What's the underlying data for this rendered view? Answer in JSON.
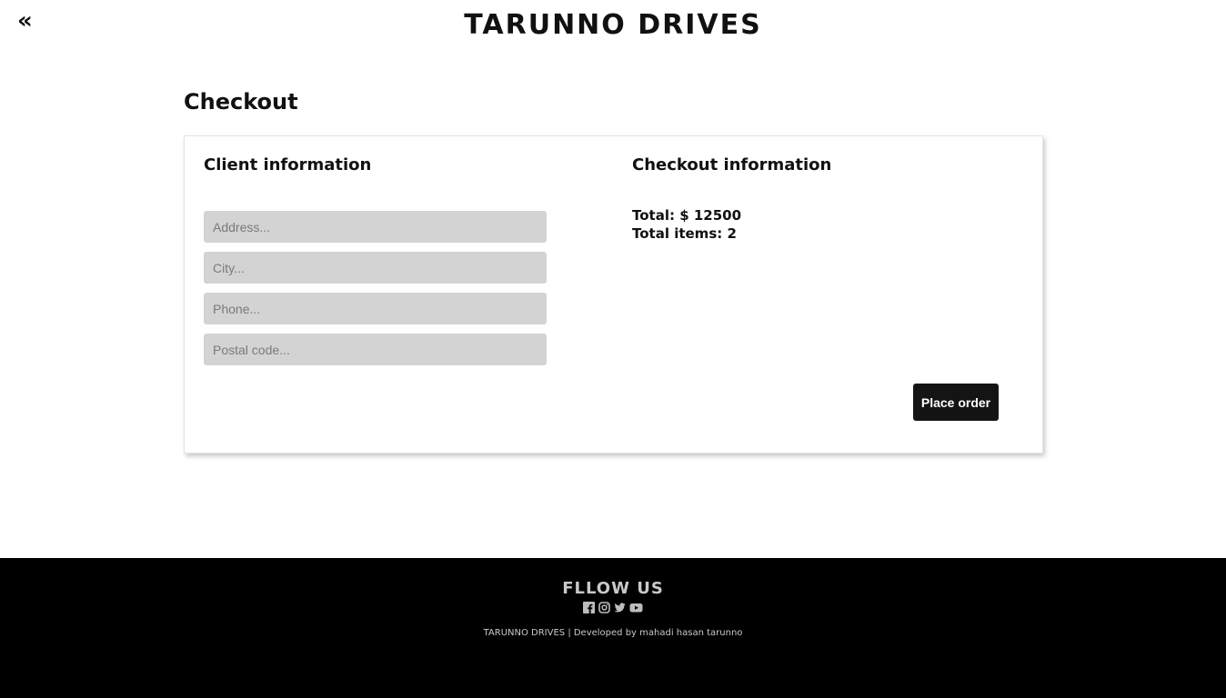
{
  "header": {
    "back_icon": "double-chevron-left-icon",
    "back_label": "«",
    "brand": "TARUNNO DRIVES"
  },
  "page": {
    "title": "Checkout"
  },
  "client": {
    "title": "Client information",
    "address_placeholder": "Address...",
    "city_placeholder": "City...",
    "phone_placeholder": "Phone...",
    "postal_placeholder": "Postal code..."
  },
  "checkout": {
    "title": "Checkout information",
    "total": "Total: $ 12500",
    "total_items": "Total items: 2",
    "place_order_label": "Place order"
  },
  "footer": {
    "follow_title": "FLLOW US",
    "socials": [
      "facebook-icon",
      "instagram-icon",
      "twitter-icon",
      "youtube-icon"
    ],
    "credit": "TARUNNO DRIVES | Developed by mahadi hasan tarunno"
  },
  "colors": {
    "background": "#ffffff",
    "text": "#111111",
    "field_bg": "#d3d3d3",
    "button_bg": "#141414",
    "footer_bg": "#000000",
    "footer_text": "#c8c8c8"
  }
}
